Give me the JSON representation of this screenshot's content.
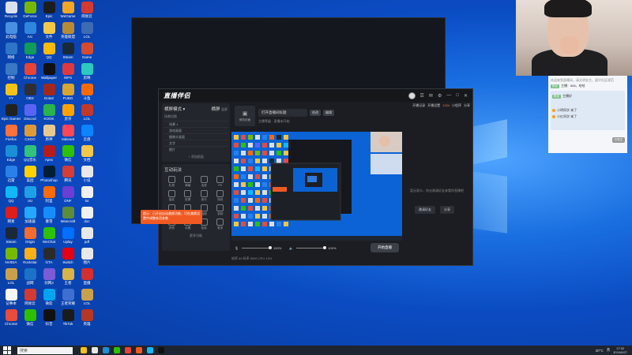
{
  "desktop": {
    "icons": [
      {
        "label": "Recycle",
        "color": "#d8e2ee"
      },
      {
        "label": "GeForce",
        "color": "#76b900"
      },
      {
        "label": "Epic",
        "color": "#1d1d1d"
      },
      {
        "label": "WeGame",
        "color": "#f5a623"
      },
      {
        "label": "网易云",
        "color": "#d33a31"
      },
      {
        "label": "此电脑",
        "color": "#4a90e2"
      },
      {
        "label": "Arc",
        "color": "#2f86de"
      },
      {
        "label": "文件",
        "color": "#f3c74a"
      },
      {
        "label": "英雄联盟",
        "color": "#b88a34"
      },
      {
        "label": "LOL",
        "color": "#3d6bb4"
      },
      {
        "label": "网络",
        "color": "#2e74c7"
      },
      {
        "label": "Edge",
        "color": "#0f9d58"
      },
      {
        "label": "QQ",
        "color": "#ffbb00"
      },
      {
        "label": "Steam",
        "color": "#1b2838"
      },
      {
        "label": "Game",
        "color": "#d44b30"
      },
      {
        "label": "控制",
        "color": "#3b78c4"
      },
      {
        "label": "Chrome",
        "color": "#e84335"
      },
      {
        "label": "Wallpaper",
        "color": "#111"
      },
      {
        "label": "WPS",
        "color": "#e0383e"
      },
      {
        "label": "剪映",
        "color": "#2cc9c0"
      },
      {
        "label": "YY",
        "color": "#f2c318"
      },
      {
        "label": "OBS",
        "color": "#302e31"
      },
      {
        "label": "Dota2",
        "color": "#a1291c"
      },
      {
        "label": "PUBG",
        "color": "#d9a52e"
      },
      {
        "label": "斗鱼",
        "color": "#ff6a00"
      },
      {
        "label": "Epic Games",
        "color": "#222"
      },
      {
        "label": "Discord",
        "color": "#5865f2"
      },
      {
        "label": "KOOK",
        "color": "#2bb34c"
      },
      {
        "label": "虎牙",
        "color": "#ffa200"
      },
      {
        "label": "LOL",
        "color": "#c0392b"
      },
      {
        "label": "Firefox",
        "color": "#ff7139"
      },
      {
        "label": "CSGO",
        "color": "#de9b35"
      },
      {
        "label": "原神",
        "color": "#e7c98f"
      },
      {
        "label": "Valorant",
        "color": "#ff4655"
      },
      {
        "label": "云盘",
        "color": "#0a84ff"
      },
      {
        "label": "Edge",
        "color": "#1b8ed6"
      },
      {
        "label": "QQ音乐",
        "color": "#31c27c"
      },
      {
        "label": "Apex",
        "color": "#b71c1c"
      },
      {
        "label": "微信",
        "color": "#2dc100"
      },
      {
        "label": "文档",
        "color": "#f3c74a"
      },
      {
        "label": "迅雷",
        "color": "#2a80e8"
      },
      {
        "label": "美团",
        "color": "#ffd100"
      },
      {
        "label": "Photoshop",
        "color": "#001e36"
      },
      {
        "label": "腾讯",
        "color": "#d43e34"
      },
      {
        "label": "小说",
        "color": "#e8e8e8"
      },
      {
        "label": "QQ",
        "color": "#12b7f5"
      },
      {
        "label": "UU",
        "color": "#1ea0e6"
      },
      {
        "label": "阿里",
        "color": "#ff6a00"
      },
      {
        "label": "DNF",
        "color": "#6b3ed4"
      },
      {
        "label": "txt",
        "color": "#f0f0f0"
      },
      {
        "label": "网易",
        "color": "#e11c1c"
      },
      {
        "label": "加速器",
        "color": "#26a7ff"
      },
      {
        "label": "暴雪",
        "color": "#148eff"
      },
      {
        "label": "Minecraft",
        "color": "#5d8c3a"
      },
      {
        "label": "doc",
        "color": "#f0f0f0"
      },
      {
        "label": "Steam",
        "color": "#1b2838"
      },
      {
        "label": "Origin",
        "color": "#f56c2d"
      },
      {
        "label": "WeChat",
        "color": "#2dc100"
      },
      {
        "label": "Uplay",
        "color": "#0070ff"
      },
      {
        "label": "pdf",
        "color": "#e8e8e8"
      },
      {
        "label": "NVIDIA",
        "color": "#76b900"
      },
      {
        "label": "Rockstar",
        "color": "#fcaf17"
      },
      {
        "label": "GTA",
        "color": "#2b2b2b"
      },
      {
        "label": "Switch",
        "color": "#e60012"
      },
      {
        "label": "图片",
        "color": "#e8e8e8"
      },
      {
        "label": "LOL",
        "color": "#c9a14b"
      },
      {
        "label": "战网",
        "color": "#1a73c7"
      },
      {
        "label": "剑网3",
        "color": "#7a5cd6"
      },
      {
        "label": "王者",
        "color": "#d9b24a"
      },
      {
        "label": "直播",
        "color": "#d32f2f"
      },
      {
        "label": "记事本",
        "color": "#f5f5f5"
      },
      {
        "label": "网易云",
        "color": "#d33a31"
      },
      {
        "label": "微软",
        "color": "#00a4ef"
      },
      {
        "label": "王者荣耀",
        "color": "#3f6fd1"
      },
      {
        "label": "LOL",
        "color": "#caa14b"
      },
      {
        "label": "Chrome",
        "color": "#e74c3c"
      },
      {
        "label": "微信",
        "color": "#2dc100"
      },
      {
        "label": "抖音",
        "color": "#111"
      },
      {
        "label": "TikTok",
        "color": "#1b1b1b"
      },
      {
        "label": "英雄",
        "color": "#b53826"
      }
    ]
  },
  "app": {
    "logo": "直播伴侣",
    "top_icons": [
      "☰",
      "✉",
      "⚙",
      "—",
      "□",
      "✕"
    ],
    "left": {
      "mode_label": "横屏模式 ▾",
      "tab_a": "横屏",
      "tab_b": "竖屏",
      "scene_header": "场景切换",
      "scene_items": [
        "场景 1",
        "游戏画面",
        "摄像头画面",
        "文字",
        "图片"
      ],
      "add_scene": "+ 添加画面",
      "tools_header": "互动玩法",
      "tools": [
        "礼物",
        "弹幕",
        "连麦",
        "PK",
        "抽奖",
        "投票",
        "音乐",
        "特效",
        "美颜",
        "背景",
        "截图",
        "录制",
        "滤镜",
        "设置",
        "贴纸",
        "更多"
      ],
      "more": "更多功能"
    },
    "center": {
      "cover_label": "修改封面",
      "title_text": "打开直播间标题",
      "chip1": "修改",
      "chip2": "编辑",
      "row2_text": "主播等级 · 直播未开始",
      "volume1": "100%",
      "volume2": "100%",
      "live_button": "开始直播",
      "bottom_text": "帧率 60 码率 5000 CPU 12%"
    },
    "right": {
      "top_items": [
        "开播记录",
        "开播设置",
        "小程序",
        "分享"
      ],
      "rank": "1234",
      "message": "暂无观众，快去邀请好友来看你直播吧",
      "btn1": "邀请好友",
      "btn2": "分享"
    },
    "tip": "提示：已开启自动美颜功能，可在美颜设置中调整各项参数"
  },
  "chat": {
    "header": "欢迎来到直播间，请文明发言，遵守社区规范",
    "lines": [
      {
        "tag": "粉丝",
        "text": "主播：666，哈哈"
      },
      {
        "tag": "粉丝",
        "text": "主播好"
      },
      {
        "tag": "",
        "text": "小明同学 来了"
      },
      {
        "tag": "",
        "text": "小红同学 来了"
      }
    ],
    "badge": "已关注"
  },
  "taskbar": {
    "search_placeholder": "搜索",
    "weather": "30°C",
    "tray_text": "英",
    "time": "17:32",
    "date": "2024/6/27"
  }
}
